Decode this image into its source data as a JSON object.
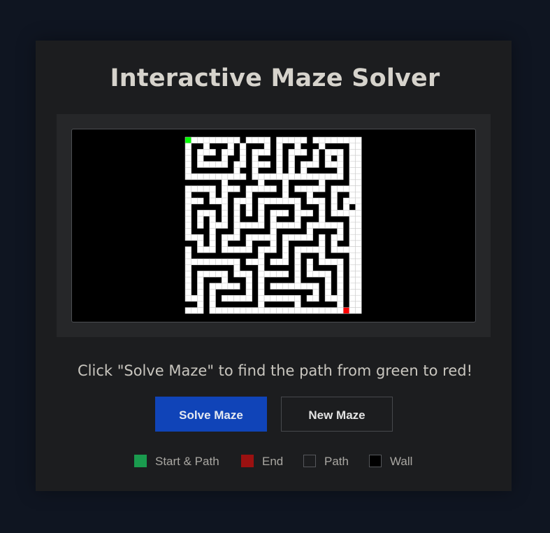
{
  "title": "Interactive Maze Solver",
  "instruction": "Click \"Solve Maze\" to find the path from green to red!",
  "buttons": {
    "solve_label": "Solve Maze",
    "new_label": "New Maze"
  },
  "legend": [
    {
      "label": "Start & Path",
      "color": "#1a9b4e",
      "border": "#1a9b4e"
    },
    {
      "label": "End",
      "color": "#9b1111",
      "border": "#9b1111"
    },
    {
      "label": "Path",
      "color": "#1c1d1f",
      "border": "#55575b"
    },
    {
      "label": "Wall",
      "color": "#000000",
      "border": "#55575b"
    }
  ],
  "maze": {
    "cols": 29,
    "rows": 29,
    "path_color": "#ffffff",
    "wall_color": "#000000",
    "start_color": "#00ff00",
    "end_color": "#ff0000",
    "grid": [
      "S111111110111101111101111111B",
      "1001000101000101001000100001C",
      "1011101101011101011101011101C",
      "1010001001010001010001010101C",
      "1011111011011101010111011101C",
      "1000000010010001010100000101C",
      "1111111111011111111111111101C",
      "0000001000001000100000100001C",
      "1111101110111110101111101111C",
      "1000101000100000100010001001C",
      "1110111011101111111011101011C",
      "1000001010101000001000101010C",
      "1011101010101011101110101111C",
      "1010101010001010001000100001C",
      "1010111011111011111011111101C",
      "1000100010000010000010000101C",
      "1110101110111110111110101101C",
      "0010101000100010100000101001C",
      "1011101111101110101111101111C",
      "1000000000001000101000100001C",
      "1111111110111011101010111101C",
      "1000000010001000001010000101C",
      "1011111011101111101011110101C",
      "1010001000101000001000010101C",
      "1010111110101011111111010101C",
      "1010100000101000000001010101C",
      "1110101111101111111011011101C",
      "0010100000001000001000000101C",
      "11101111111111111111111111E1C"
    ]
  }
}
